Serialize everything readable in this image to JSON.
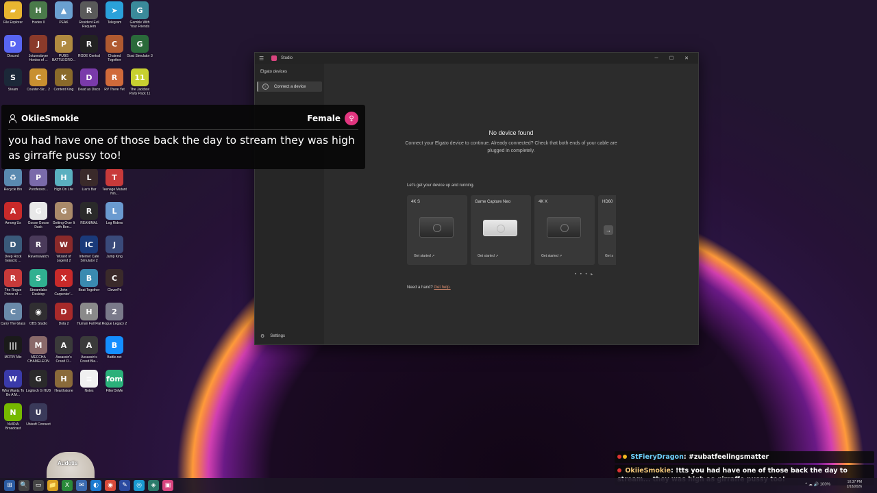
{
  "desktop": {
    "icons": [
      {
        "label": "File Explorer",
        "glyph": "▰",
        "color": "#e8b530"
      },
      {
        "label": "Hades II",
        "glyph": "H",
        "color": "#4a7a4a"
      },
      {
        "label": "PEAK",
        "glyph": "▲",
        "color": "#6aa0d0"
      },
      {
        "label": "Resident Evil Requiem",
        "glyph": "R",
        "color": "#5a5a5a"
      },
      {
        "label": "Telegram",
        "glyph": "➤",
        "color": "#2aa1da"
      },
      {
        "label": "Gamble With Your Friends",
        "glyph": "G",
        "color": "#3a8a9a"
      },
      {
        "label": "Discord",
        "glyph": "D",
        "color": "#5865f2"
      },
      {
        "label": "Jotunnslayer Hordes of ...",
        "glyph": "J",
        "color": "#8a3a2a"
      },
      {
        "label": "PUBG BATTLEGRO...",
        "glyph": "P",
        "color": "#b08a40"
      },
      {
        "label": "RODE Central",
        "glyph": "R",
        "color": "#222222"
      },
      {
        "label": "Chained Together",
        "glyph": "C",
        "color": "#b05a30"
      },
      {
        "label": "Goat Simulator 3",
        "glyph": "G",
        "color": "#2a6a3a"
      },
      {
        "label": "Steam",
        "glyph": "S",
        "color": "#1b2838"
      },
      {
        "label": "Counter-Str... 2",
        "glyph": "C",
        "color": "#c89030"
      },
      {
        "label": "Content King",
        "glyph": "K",
        "color": "#8a6a2a"
      },
      {
        "label": "Dead as Disco",
        "glyph": "D",
        "color": "#7a3aaa"
      },
      {
        "label": "RV There Yet",
        "glyph": "R",
        "color": "#d06a3a"
      },
      {
        "label": "The Jackbox Party Pack 11",
        "glyph": "11",
        "color": "#c8d030"
      },
      {
        "label": "Recycle Bin",
        "glyph": "♻",
        "color": "#5a8ab0"
      },
      {
        "label": "Porofessor...",
        "glyph": "P",
        "color": "#7a6aaa"
      },
      {
        "label": "High On Life",
        "glyph": "H",
        "color": "#5ab0c0"
      },
      {
        "label": "Liar's Bar",
        "glyph": "L",
        "color": "#3a2a2a"
      },
      {
        "label": "Teenage Mutant Nin...",
        "glyph": "T",
        "color": "#c83a3a"
      },
      {
        "label": "Among Us",
        "glyph": "A",
        "color": "#c82a2a"
      },
      {
        "label": "Goose Goose Duck",
        "glyph": "G",
        "color": "#e8e8e8"
      },
      {
        "label": "Getting Over It with Ben...",
        "glyph": "G",
        "color": "#aa8a6a"
      },
      {
        "label": "REANIMAL",
        "glyph": "R",
        "color": "#2a2a2a"
      },
      {
        "label": "Log Riders",
        "glyph": "L",
        "color": "#6a9ad0"
      },
      {
        "label": "Deep Rock Galactic ...",
        "glyph": "D",
        "color": "#3a5a7a"
      },
      {
        "label": "Ravenswatch",
        "glyph": "R",
        "color": "#4a3a5a"
      },
      {
        "label": "Wizard of Legend 2",
        "glyph": "W",
        "color": "#8a2a2a"
      },
      {
        "label": "Internet Cafe Simulator 2",
        "glyph": "IC",
        "color": "#1a3a7a"
      },
      {
        "label": "Jump King",
        "glyph": "J",
        "color": "#3a4a7a"
      },
      {
        "label": "The Rogue Prince of ...",
        "glyph": "R",
        "color": "#c83a3a"
      },
      {
        "label": "Streamlabs Desktop",
        "glyph": "S",
        "color": "#30b090"
      },
      {
        "label": "John Carpenter'...",
        "glyph": "X",
        "color": "#c82a2a"
      },
      {
        "label": "Boat Together",
        "glyph": "B",
        "color": "#3a8ab0"
      },
      {
        "label": "CloverPit",
        "glyph": "C",
        "color": "#3a2a2a"
      },
      {
        "label": "Carry The Glass",
        "glyph": "C",
        "color": "#6a8aaa"
      },
      {
        "label": "OBS Studio",
        "glyph": "◉",
        "color": "#302e31"
      },
      {
        "label": "Dota 2",
        "glyph": "D",
        "color": "#a82a2a"
      },
      {
        "label": "Human Fall Flat",
        "glyph": "H",
        "color": "#8a8a8a"
      },
      {
        "label": "Rogue Legacy 2",
        "glyph": "2",
        "color": "#7a7a8a"
      },
      {
        "label": "MOTIV Mix",
        "glyph": "|||",
        "color": "#1a1a1a"
      },
      {
        "label": "MECCHA CHAMELEON",
        "glyph": "M",
        "color": "#8a6a6a"
      },
      {
        "label": "Assassin's Creed O...",
        "glyph": "A",
        "color": "#3a3a3a"
      },
      {
        "label": "Assassin's Creed Bla...",
        "glyph": "A",
        "color": "#3a3a3a"
      },
      {
        "label": "Battle.net",
        "glyph": "B",
        "color": "#148eff"
      },
      {
        "label": "Who Wants To Be A M...",
        "glyph": "W",
        "color": "#3a3aaa"
      },
      {
        "label": "Logitech G HUB",
        "glyph": "G",
        "color": "#2a2a2a"
      },
      {
        "label": "Hearthstone",
        "glyph": "H",
        "color": "#8a6a3a"
      },
      {
        "label": "Notes",
        "glyph": "≡",
        "color": "#f0f0f0"
      },
      {
        "label": "FilterOnMe",
        "glyph": "fom",
        "color": "#2ab07a"
      },
      {
        "label": "NVIDIA Broadcast",
        "glyph": "N",
        "color": "#76b900"
      },
      {
        "label": "Ubisoft Connect",
        "glyph": "U",
        "color": "#3a3a5a"
      }
    ]
  },
  "window": {
    "title": "Studio",
    "menu_icon": "hamburger-icon",
    "minimize": "─",
    "maximize": "☐",
    "close": "✕",
    "sidebar": {
      "heading": "Elgato devices",
      "connect_label": "Connect a device",
      "connect_icon": "ⓘ",
      "settings_label": "Settings",
      "settings_icon": "⚙"
    },
    "main": {
      "no_device_title": "No device found",
      "no_device_text": "Connect your Elgato device to continue. Already connected? Check that both ends of your cable are plugged in completely.",
      "lets_get": "Let's get your device up and running.",
      "cards": [
        {
          "name": "4K S",
          "action": "Get started ↗",
          "style": "dark"
        },
        {
          "name": "Game Capture Neo",
          "action": "Get started ↗",
          "style": "light"
        },
        {
          "name": "4K X",
          "action": "Get started ↗",
          "style": "dark"
        },
        {
          "name": "HD60",
          "action": "Get s",
          "style": "arrow"
        }
      ],
      "dots": "• • • ▸",
      "need_hand": "Need a hand?",
      "help_link": "Get help."
    }
  },
  "tts": {
    "username": "OkiieSmokie",
    "voice": "Female",
    "voice_icon": "♀",
    "message": "you had have one of those back the day to stream they was high as girraffe pussy too!"
  },
  "chat": [
    {
      "name": "StFieryDragon",
      "text": ": #zubatfeelingsmatter"
    },
    {
      "name": "OkiieSmokie",
      "text": ": !tts you had have one of those back the day to stream... they was high as girraffe pussy too!"
    }
  ],
  "overlay": {
    "chair_text": "Audetis"
  },
  "taskbar": {
    "apps": [
      "⊞",
      "🔍",
      "▭",
      "📁",
      "X",
      "✉",
      "◐",
      "◉",
      "✎",
      "◎",
      "◈",
      "▣"
    ],
    "tray_text": "^ ☁ 🔊 100%",
    "time": "10:37 PM",
    "date": "2/18/2026"
  }
}
